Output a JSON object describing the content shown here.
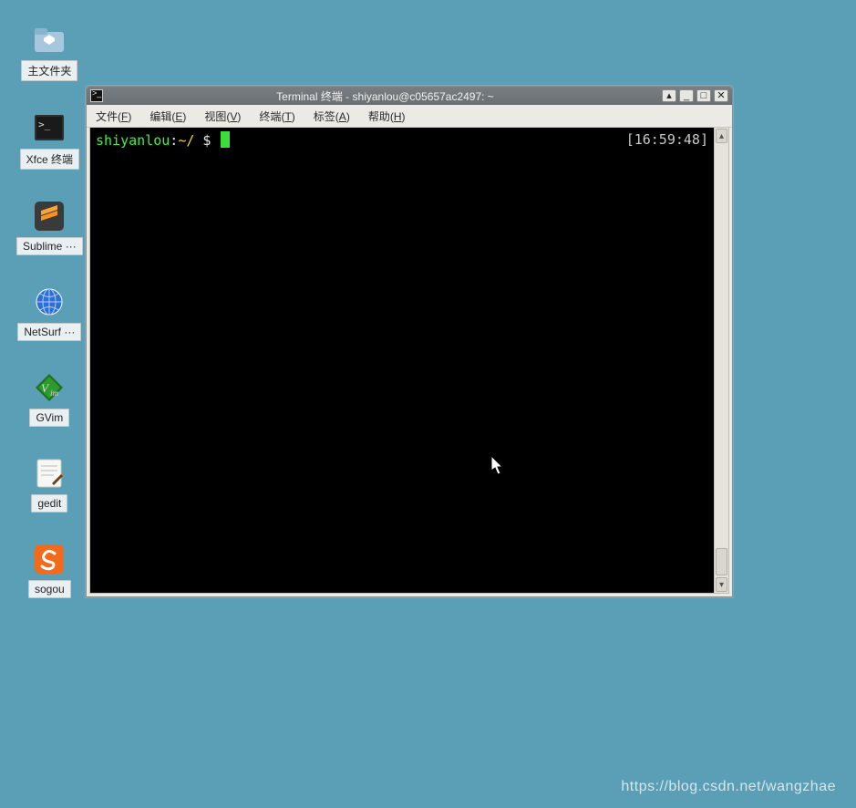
{
  "desktop": {
    "icons": [
      {
        "id": "home-folder",
        "label": "主文件夹"
      },
      {
        "id": "xfce-terminal",
        "label": "Xfce 终端"
      },
      {
        "id": "sublime",
        "label": "Sublime ···"
      },
      {
        "id": "netsurf",
        "label": "NetSurf ···"
      },
      {
        "id": "gvim",
        "label": "GVim"
      },
      {
        "id": "gedit",
        "label": "gedit"
      },
      {
        "id": "sogou",
        "label": "sogou"
      }
    ]
  },
  "window": {
    "title": "Terminal 终端 - shiyanlou@c05657ac2497: ~",
    "buttons": {
      "shade": "▴",
      "min": "_",
      "max": "□",
      "close": "✕"
    }
  },
  "menubar": {
    "items": [
      {
        "label": "文件",
        "accel": "F"
      },
      {
        "label": "编辑",
        "accel": "E"
      },
      {
        "label": "视图",
        "accel": "V"
      },
      {
        "label": "终端",
        "accel": "T"
      },
      {
        "label": "标签",
        "accel": "A"
      },
      {
        "label": "帮助",
        "accel": "H"
      }
    ]
  },
  "terminal": {
    "prompt": {
      "user": "shiyanlou",
      "colon_path": ":~/",
      "dollar": " $ "
    },
    "timestamp": "[16:59:48]"
  },
  "watermark": "https://blog.csdn.net/wangzhae"
}
